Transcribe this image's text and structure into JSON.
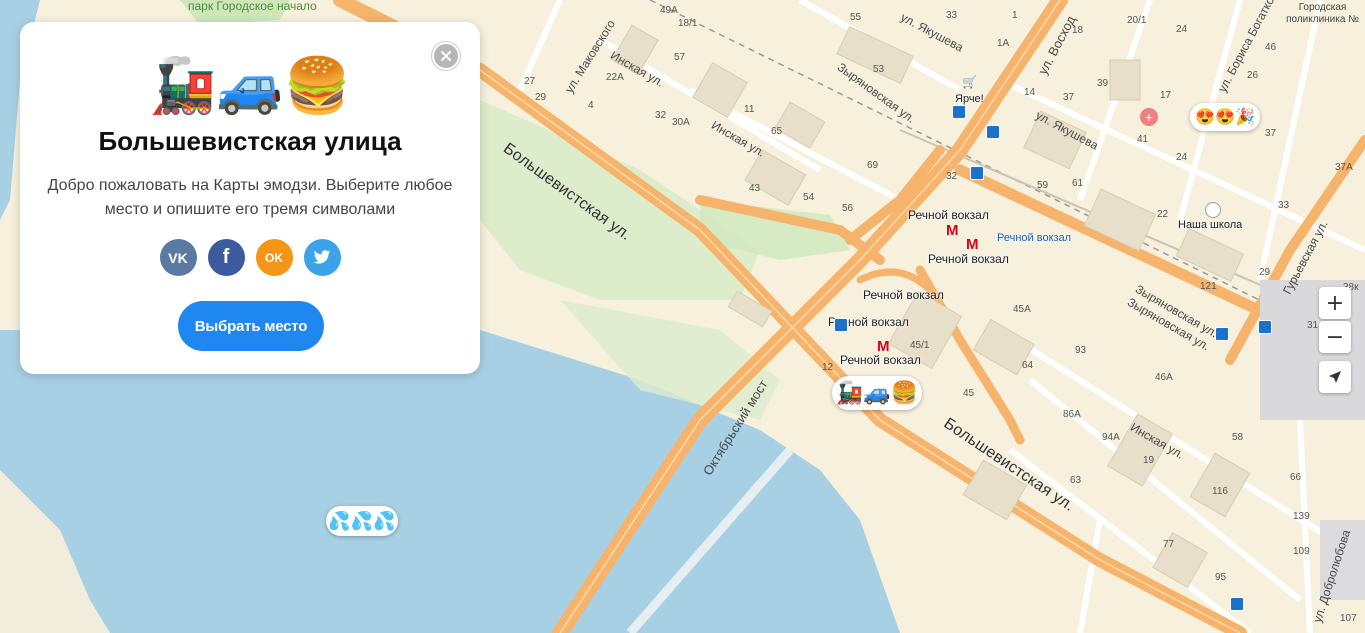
{
  "card": {
    "emoji": "🚂🚙🍔",
    "title": "Большевистская улица",
    "description": "Добро пожаловать на Карты эмодзи. Выберите любое место и опишите его тремя символами",
    "share": {
      "vk": "VK",
      "facebook": "f",
      "odnoklassniki": "OK",
      "twitter": "twitter"
    },
    "choose_button": "Выбрать место"
  },
  "pins": {
    "main": "🚂🚙🍔",
    "water": "💦💦💦",
    "top_right": "😍😍🎉"
  },
  "controls": {
    "zoom_in": "+",
    "zoom_out": "−",
    "locate": "➤"
  },
  "map": {
    "streets": {
      "bolshevistskaya_1": "Большевистская ул.",
      "bolshevistskaya_2": "Большевистская ул.",
      "oktyabrsky_most": "Октябрьский мост",
      "voskhod": "ул. Восход",
      "yakusheva_1": "ул. Якушева",
      "yakusheva_2": "ул. Якушева",
      "zyryanovskaya_1": "Зыряновская ул.",
      "zyryanovskaya_2": "Зыряновская ул.",
      "zyryanovskaya_3": "Зыряновская ул.",
      "inskaya_1": "Инская ул.",
      "inskaya_2": "Инская ул.",
      "inskaya_3": "Инская ул.",
      "mayakovskogo": "ул. Маковского",
      "bogatkova": "ул. Бориса Богатко",
      "guryevskaya": "Гурьевская ул.",
      "dobrolyubova": "ул. Добролюбова"
    },
    "pois": {
      "park": "парк Городское начало",
      "clinic": "Городская поликлиника №",
      "rechnoy_1": "Речной вокзал",
      "rechnoy_2": "Речной вокзал",
      "rechnoy_3": "Речной вокзал",
      "rechnoy_4": "Речной вокзал",
      "rechnoy_5": "Речной вокзал",
      "rechnoy_6": "Речной вокзал",
      "yarche": "Ярче!",
      "school": "Наша школа"
    },
    "metro_symbol": "M",
    "house_numbers": [
      "49А",
      "18/1",
      "55",
      "33",
      "1",
      "20/1",
      "17",
      "24",
      "46",
      "27",
      "29",
      "22А",
      "4",
      "57",
      "32",
      "30А",
      "11",
      "65",
      "53",
      "1А",
      "14",
      "18",
      "39",
      "37",
      "41",
      "26",
      "37",
      "69",
      "32",
      "59",
      "61",
      "24",
      "22",
      "33",
      "43",
      "54",
      "56",
      "121",
      "45А",
      "29",
      "31",
      "45/1",
      "12",
      "93",
      "46А",
      "64",
      "45",
      "86А",
      "94А",
      "58",
      "19",
      "63",
      "66",
      "116",
      "139",
      "77",
      "95",
      "109",
      "107",
      "38к",
      "37А"
    ]
  }
}
